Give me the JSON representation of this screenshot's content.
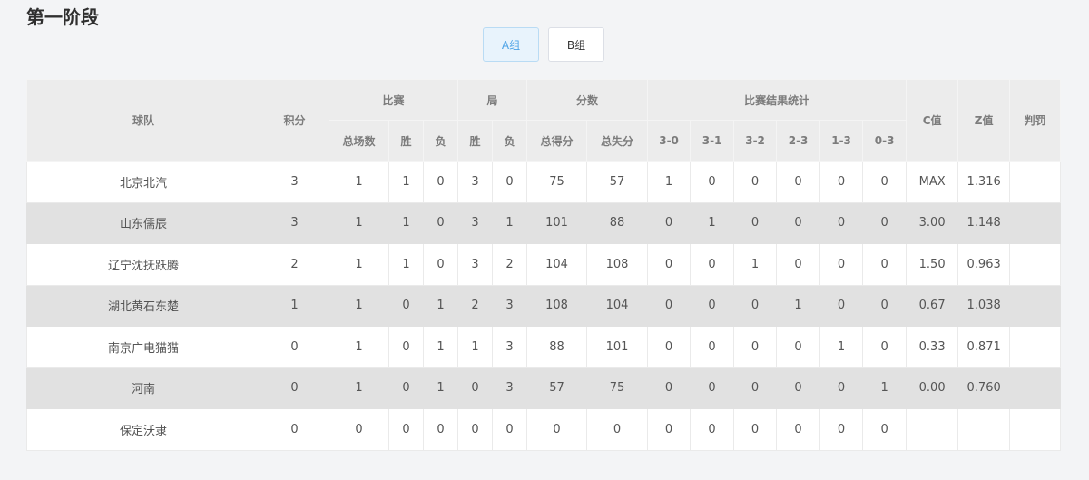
{
  "page": {
    "title": "第一阶段"
  },
  "tabs": [
    {
      "label": "A组",
      "active": true
    },
    {
      "label": "B组",
      "active": false
    }
  ],
  "table": {
    "headers": {
      "team": "球队",
      "points": "积分",
      "matches": "比赛",
      "matches_total": "总场数",
      "matches_win": "胜",
      "matches_loss": "负",
      "sets": "局",
      "sets_win": "胜",
      "sets_loss": "负",
      "score": "分数",
      "score_for": "总得分",
      "score_against": "总失分",
      "results": "比赛结果统计",
      "r30": "3-0",
      "r31": "3-1",
      "r32": "3-2",
      "r23": "2-3",
      "r13": "1-3",
      "r03": "0-3",
      "c": "C值",
      "z": "Z值",
      "penalty": "判罚"
    },
    "rows": [
      {
        "team": "北京北汽",
        "points": "3",
        "total": "1",
        "win": "1",
        "loss": "0",
        "swin": "3",
        "sloss": "0",
        "for": "75",
        "against": "57",
        "r30": "1",
        "r31": "0",
        "r32": "0",
        "r23": "0",
        "r13": "0",
        "r03": "0",
        "c": "MAX",
        "z": "1.316",
        "penalty": ""
      },
      {
        "team": "山东儒辰",
        "points": "3",
        "total": "1",
        "win": "1",
        "loss": "0",
        "swin": "3",
        "sloss": "1",
        "for": "101",
        "against": "88",
        "r30": "0",
        "r31": "1",
        "r32": "0",
        "r23": "0",
        "r13": "0",
        "r03": "0",
        "c": "3.00",
        "z": "1.148",
        "penalty": ""
      },
      {
        "team": "辽宁沈抚跃腾",
        "points": "2",
        "total": "1",
        "win": "1",
        "loss": "0",
        "swin": "3",
        "sloss": "2",
        "for": "104",
        "against": "108",
        "r30": "0",
        "r31": "0",
        "r32": "1",
        "r23": "0",
        "r13": "0",
        "r03": "0",
        "c": "1.50",
        "z": "0.963",
        "penalty": ""
      },
      {
        "team": "湖北黄石东楚",
        "points": "1",
        "total": "1",
        "win": "0",
        "loss": "1",
        "swin": "2",
        "sloss": "3",
        "for": "108",
        "against": "104",
        "r30": "0",
        "r31": "0",
        "r32": "0",
        "r23": "1",
        "r13": "0",
        "r03": "0",
        "c": "0.67",
        "z": "1.038",
        "penalty": ""
      },
      {
        "team": "南京广电猫猫",
        "points": "0",
        "total": "1",
        "win": "0",
        "loss": "1",
        "swin": "1",
        "sloss": "3",
        "for": "88",
        "against": "101",
        "r30": "0",
        "r31": "0",
        "r32": "0",
        "r23": "0",
        "r13": "1",
        "r03": "0",
        "c": "0.33",
        "z": "0.871",
        "penalty": ""
      },
      {
        "team": "河南",
        "points": "0",
        "total": "1",
        "win": "0",
        "loss": "1",
        "swin": "0",
        "sloss": "3",
        "for": "57",
        "against": "75",
        "r30": "0",
        "r31": "0",
        "r32": "0",
        "r23": "0",
        "r13": "0",
        "r03": "1",
        "c": "0.00",
        "z": "0.760",
        "penalty": ""
      },
      {
        "team": "保定沃隶",
        "points": "0",
        "total": "0",
        "win": "0",
        "loss": "0",
        "swin": "0",
        "sloss": "0",
        "for": "0",
        "against": "0",
        "r30": "0",
        "r31": "0",
        "r32": "0",
        "r23": "0",
        "r13": "0",
        "r03": "0",
        "c": "",
        "z": "",
        "penalty": ""
      }
    ]
  }
}
